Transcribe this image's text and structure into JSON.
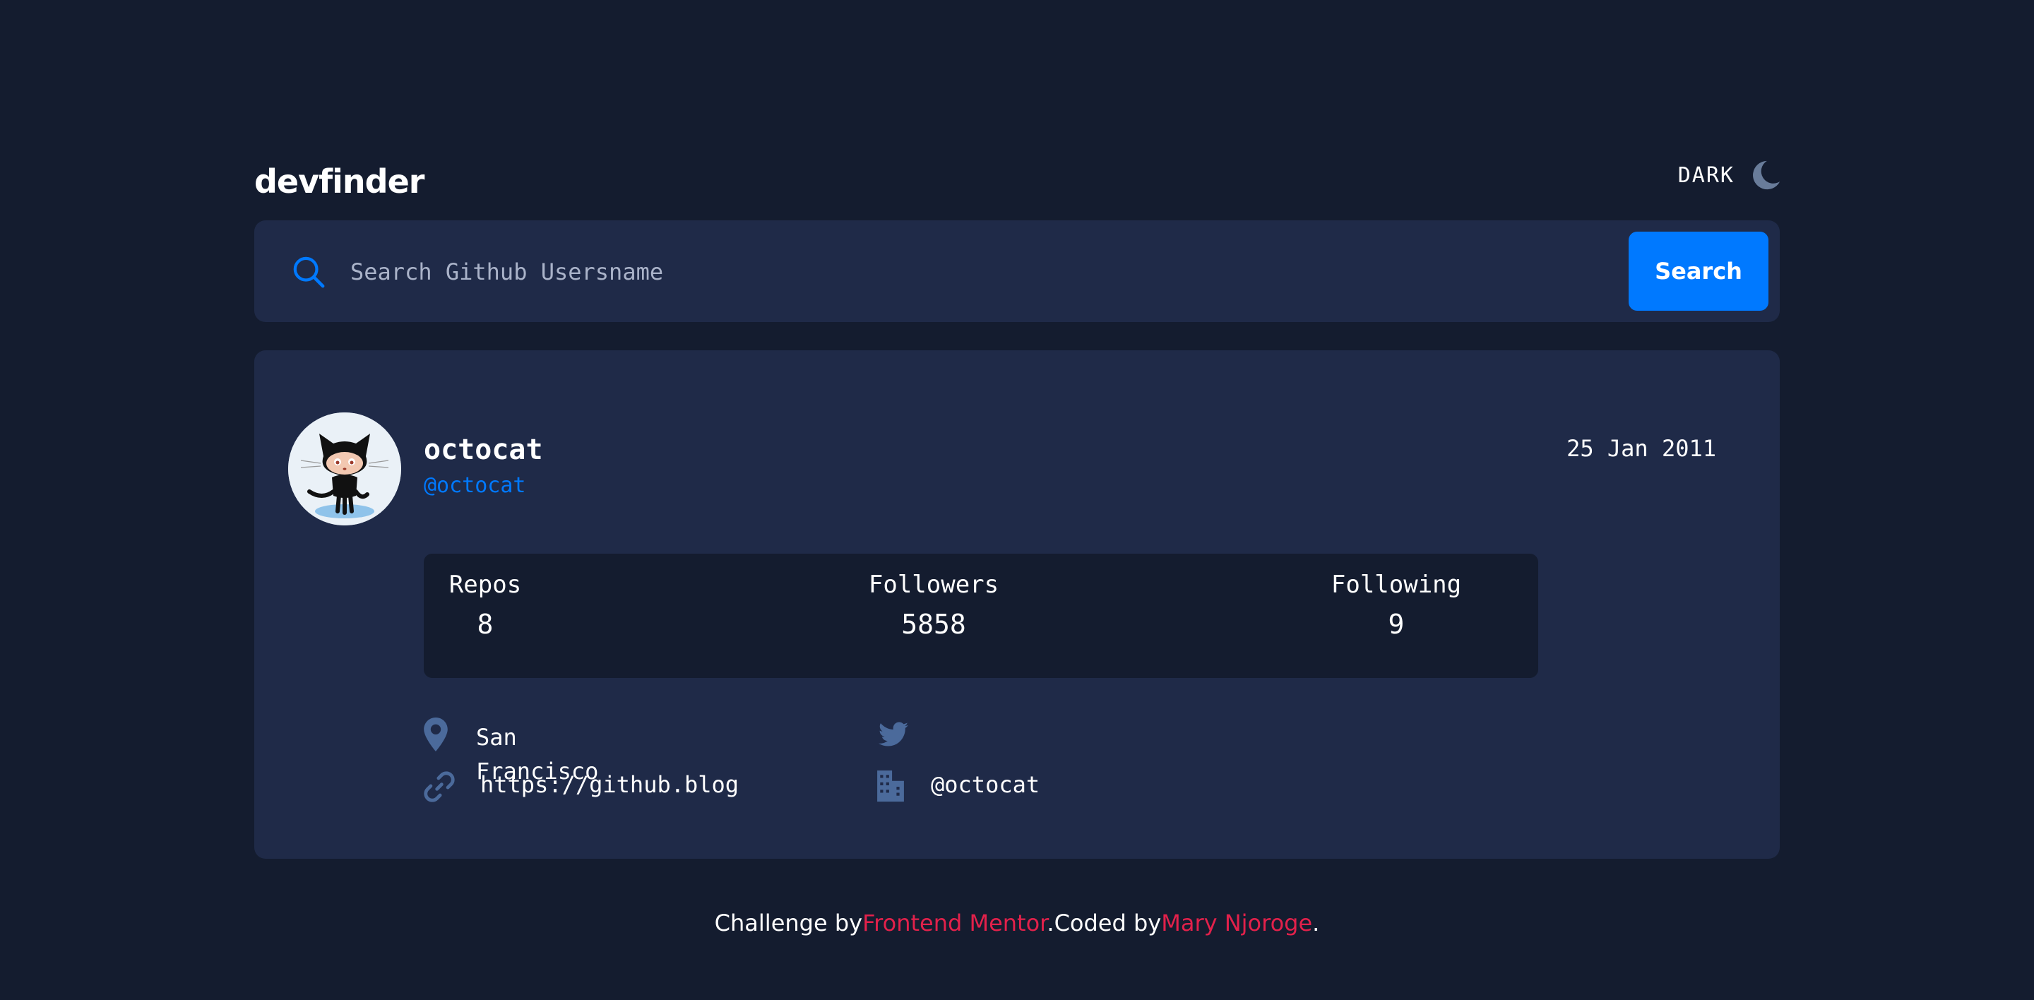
{
  "header": {
    "title": "devfinder",
    "theme_label": "DARK",
    "theme_icon": "moon-icon"
  },
  "search": {
    "placeholder": "Search Github Usersname",
    "value": "",
    "button_label": "Search",
    "icon": "search-icon"
  },
  "profile": {
    "name": "octocat",
    "login": "@octocat",
    "joined": "25 Jan 2011",
    "avatar_icon": "octocat-avatar",
    "stats": {
      "repos_label": "Repos",
      "repos_value": "8",
      "followers_label": "Followers",
      "followers_value": "5858",
      "following_label": "Following",
      "following_value": "9"
    },
    "links": {
      "location": "San Francisco",
      "twitter": "",
      "website": "https://github.blog",
      "company": "@octocat"
    }
  },
  "footer": {
    "prefix": "Challenge by",
    "link1": "Frontend Mentor",
    "middle": ".Coded by",
    "link2": "Mary Njoroge",
    "suffix": "."
  },
  "colors": {
    "background": "#141c2f",
    "card": "#1f2a48",
    "accent": "#0079ff",
    "footer_link": "#e2214b",
    "icon": "#4b6a9b"
  }
}
